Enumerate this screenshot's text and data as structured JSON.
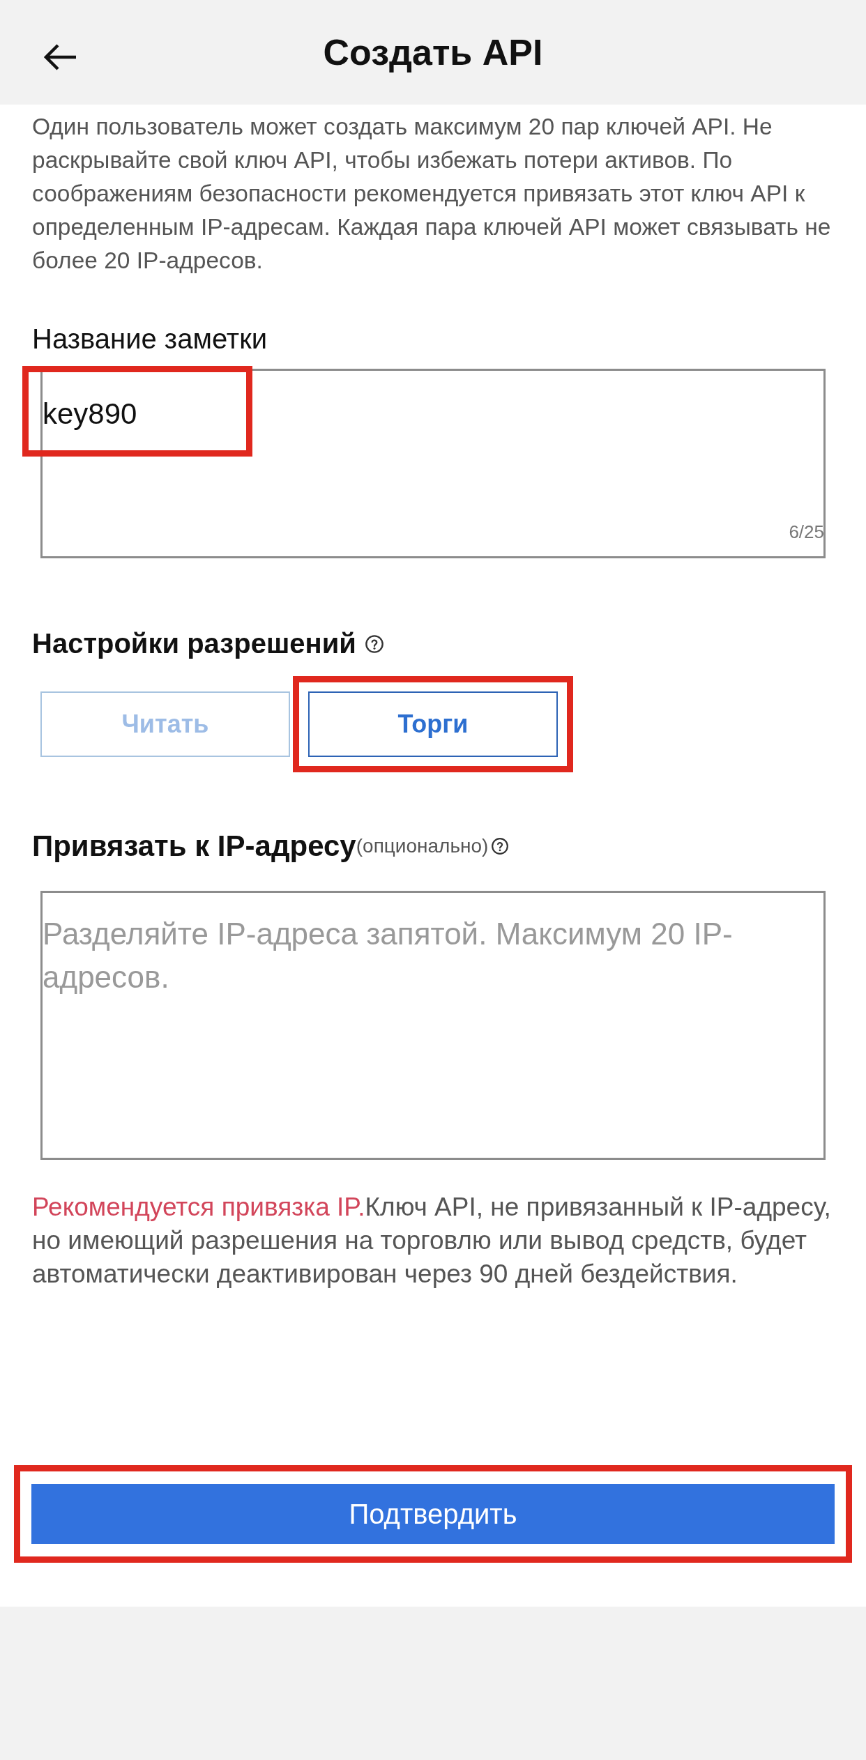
{
  "header": {
    "title": "Создать API"
  },
  "intro": "Один пользователь может создать максимум 20 пар ключей API. Не раскрывайте свой ключ API, чтобы избежать потери активов. По соображениям безопасности рекомендуется привязать этот ключ API к определенным IP-адресам. Каждая пара ключей API может связывать не более 20 IP-адресов.",
  "note": {
    "label": "Название заметки",
    "value": "key890",
    "counter": "6/25",
    "highlighted": true
  },
  "permissions": {
    "label": "Настройки разрешений",
    "options": [
      {
        "label": "Читать",
        "selected": false,
        "highlighted": false
      },
      {
        "label": "Торги",
        "selected": true,
        "highlighted": true
      }
    ]
  },
  "ip": {
    "label": "Привязать к IP-адресу",
    "hint": "(опционально)",
    "placeholder": "Разделяйте IP-адреса запятой. Максимум 20 IP-адресов."
  },
  "warning": {
    "highlight": "Рекомендуется привязка IP.",
    "text": "Ключ API, не привязанный к IP-адресу, но имеющий разрешения на торговлю или вывод средств, будет автоматически деактивирован через 90 дней бездействия."
  },
  "confirm_button": {
    "label": "Подтвердить",
    "highlighted": true
  }
}
